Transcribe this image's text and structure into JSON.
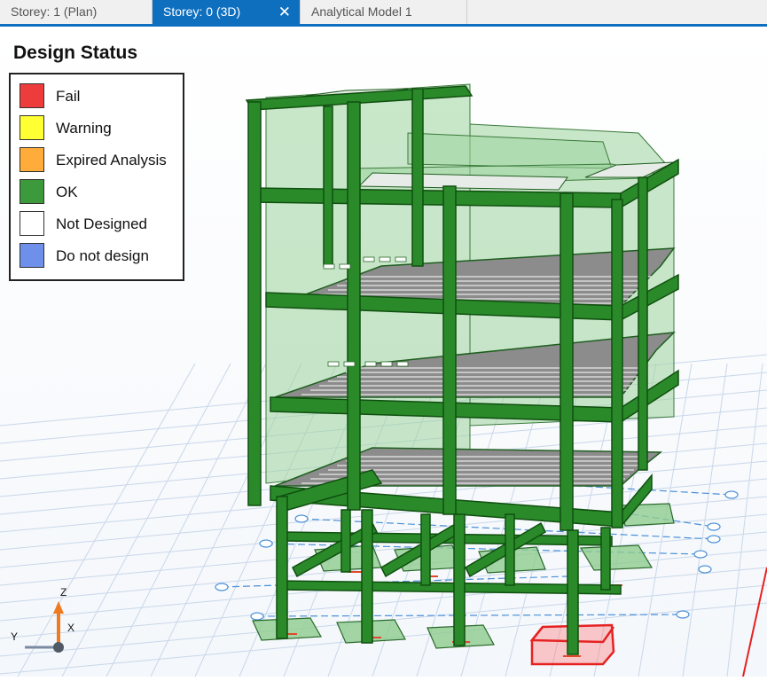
{
  "tabs": [
    {
      "label": "Storey: 1 (Plan)",
      "active": false
    },
    {
      "label": "Storey: 0 (3D)",
      "active": true,
      "close": "✕"
    },
    {
      "label": "Analytical Model 1",
      "active": false
    }
  ],
  "legend": {
    "title": "Design Status",
    "items": [
      {
        "label": "Fail",
        "color": "#ee3b3b"
      },
      {
        "label": "Warning",
        "color": "#ffff33"
      },
      {
        "label": "Expired Analysis",
        "color": "#ffac3a"
      },
      {
        "label": "OK",
        "color": "#3c9a3c"
      },
      {
        "label": "Not Designed",
        "color": "#ffffff"
      },
      {
        "label": "Do not design",
        "color": "#6e8fea"
      }
    ]
  },
  "axes": {
    "z": "Z",
    "y": "Y",
    "x": "X"
  },
  "colors": {
    "active_tab": "#0e6fbf",
    "member_ok": "#1f7a1f",
    "panel": "#9cd49c",
    "grid": "#c7d5ea",
    "gridline_dash": "#4a90d8",
    "fail_outline": "#e52222"
  }
}
